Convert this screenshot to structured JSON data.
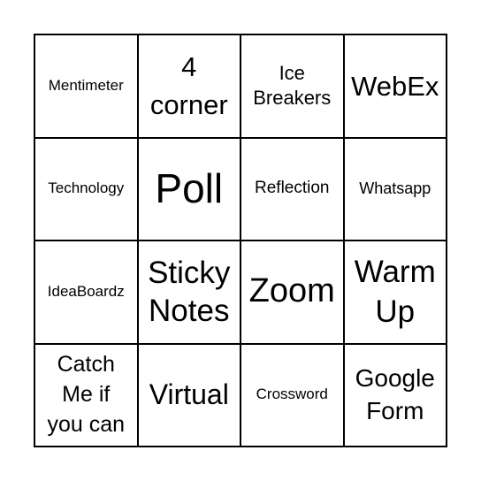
{
  "board": {
    "cells": [
      {
        "text": "Mentimeter"
      },
      {
        "text": "4\ncorner"
      },
      {
        "text": "Ice\nBreakers"
      },
      {
        "text": "WebEx"
      },
      {
        "text": "Technology"
      },
      {
        "text": "Poll"
      },
      {
        "text": "Reflection"
      },
      {
        "text": "Whatsapp"
      },
      {
        "text": "IdeaBoardz"
      },
      {
        "text": "Sticky\nNotes"
      },
      {
        "text": "Zoom"
      },
      {
        "text": "Warm\nUp"
      },
      {
        "text": "Catch\nMe if\nyou can"
      },
      {
        "text": "Virtual"
      },
      {
        "text": "Crossword"
      },
      {
        "text": "Google\nForm"
      }
    ]
  }
}
